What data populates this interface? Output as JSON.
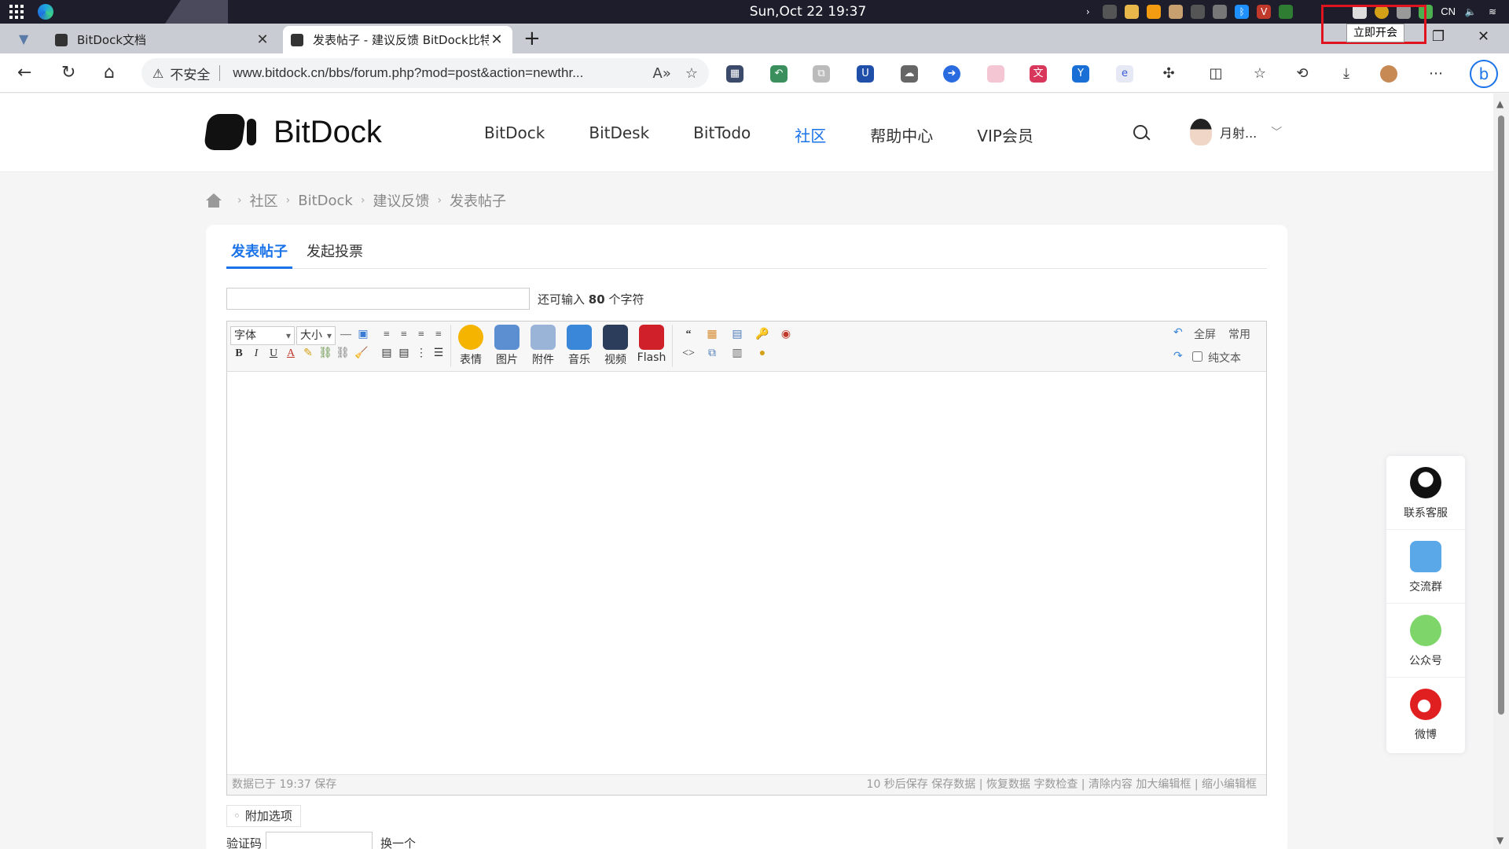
{
  "os": {
    "clock": "Sun,Oct 22  19:37",
    "lang": "CN"
  },
  "meeting_tooltip": "立即开会",
  "tabs": [
    {
      "title": "BitDock文档"
    },
    {
      "title": "发表帖子 - 建议反馈 BitDock比特"
    }
  ],
  "address": {
    "security_label": "不安全",
    "url": "www.bitdock.cn/bbs/forum.php?mod=post&action=newthr..."
  },
  "site": {
    "brand": "BitDock",
    "nav": [
      "BitDock",
      "BitDesk",
      "BitTodo",
      "社区",
      "帮助中心",
      "VIP会员"
    ],
    "user_name": "月射..."
  },
  "breadcrumb": [
    "社区",
    "BitDock",
    "建议反馈",
    "发表帖子"
  ],
  "post_tabs": [
    "发表帖子",
    "发起投票"
  ],
  "subject": {
    "remain_prefix": "还可输入",
    "remain_count": "80",
    "remain_suffix": "个字符"
  },
  "editor": {
    "font_select": "字体",
    "size_select": "大小",
    "insert_buttons": [
      "表情",
      "图片",
      "附件",
      "音乐",
      "视频",
      "Flash"
    ],
    "fullscreen": "全屏",
    "common": "常用",
    "plain_text": "纯文本",
    "status_left": "数据已于 19:37 保存",
    "status_right": "10 秒后保存 保存数据 | 恢复数据    字数检查 | 清除内容    加大编辑框 | 缩小编辑框"
  },
  "extra_options": "附加选项",
  "captcha": {
    "label": "验证码",
    "change": "换一个"
  },
  "float_panel": [
    "联系客服",
    "交流群",
    "公众号",
    "微博"
  ]
}
